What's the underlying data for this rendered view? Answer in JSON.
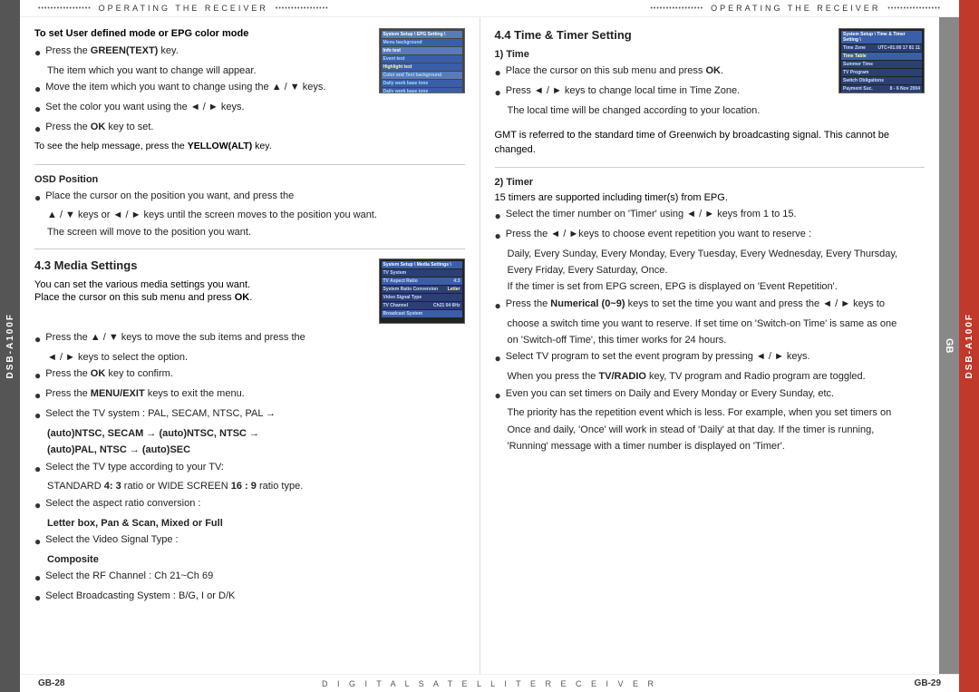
{
  "left_side_tab": "DSB-A100F",
  "right_side_tab": "DSB-A100F",
  "gb_tab": "GB",
  "header": {
    "dots_left": "•••••••••••••••••",
    "title_left": "OPERATING THE RECEIVER",
    "dots_right_1": "•••••••••••••••••",
    "dots_left_2": "•••••••••••••••••",
    "title_right": "OPERATING THE RECEIVER",
    "dots_right_2": "•••••••••••••••••"
  },
  "footer": {
    "left_page": "GB-28",
    "center": "D I G I T A L   S A T E L L I T E   R E C E I V E R",
    "right_page": "GB-29"
  },
  "left_column": {
    "set_user_defined_title": "To set User defined mode or EPG color mode",
    "set_user_defined_bullets": [
      {
        "bullet": "●",
        "text": "Press the GREEN(TEXT) key."
      },
      {
        "bullet": "",
        "indent": true,
        "text": "The item which you want to change will appear."
      },
      {
        "bullet": "●",
        "text": "Move the item which you want to change using the ▲ / ▼ keys."
      },
      {
        "bullet": "●",
        "text": "Set the color you want using the ◄ / ► keys."
      },
      {
        "bullet": "●",
        "text": "Press the OK key to set."
      }
    ],
    "yellow_alt_text": "To see the help message, press the YELLOW(ALT) key.",
    "osd_position_title": "OSD Position",
    "osd_position_bullets": [
      {
        "bullet": "●",
        "text": "Place the cursor on the position you want, and press the"
      },
      {
        "indent": true,
        "text": "▲ / ▼ keys or ◄ / ► keys until the screen moves to the position you want."
      },
      {
        "indent": true,
        "text": "The screen will move to the position you want."
      }
    ],
    "media_settings_title": "4.3 Media Settings",
    "media_settings_intro1": "You can set the various media settings you want.",
    "media_settings_intro2": "Place the cursor on this sub menu and press OK.",
    "media_settings_bullets": [
      {
        "bullet": "●",
        "text": "Press the ▲ / ▼ keys to move the sub items and press the"
      },
      {
        "indent": true,
        "text": "◄ / ► keys to select the option."
      },
      {
        "bullet": "●",
        "text": "Press the OK key to confirm."
      },
      {
        "bullet": "●",
        "text": "Press the MENU/EXIT keys to exit the menu."
      },
      {
        "bullet": "●",
        "text": "Select the TV system : PAL, SECAM, NTSC, PAL →"
      },
      {
        "indent": true,
        "bold": true,
        "text": "(auto)NTSC, SECAM → (auto)NTSC, NTSC →"
      },
      {
        "indent": true,
        "bold": true,
        "text": "(auto)PAL, NTSC → (auto)SEC"
      },
      {
        "bullet": "●",
        "text": "Select the TV type according to your TV:"
      },
      {
        "indent": true,
        "text": "STANDARD 4: 3 ratio or WIDE SCREEN 16 : 9 ratio type."
      },
      {
        "bullet": "●",
        "text": "Select the aspect ratio conversion :"
      },
      {
        "indent": true,
        "bold": true,
        "text": "Letter box, Pan & Scan, Mixed or Full"
      },
      {
        "bullet": "●",
        "text": "Select the Video Signal Type :"
      },
      {
        "indent": true,
        "bold": true,
        "text": "Composite"
      },
      {
        "bullet": "●",
        "text": "Select the RF Channel : Ch 21~Ch 69"
      },
      {
        "bullet": "●",
        "text": "Select Broadcasting System : B/G, I or D/K"
      }
    ]
  },
  "right_column": {
    "timer_setting_title": "4.4 Time & Timer Setting",
    "time_title": "1) Time",
    "time_bullets": [
      {
        "bullet": "●",
        "text": "Place the cursor on this sub menu and press OK."
      },
      {
        "bullet": "●",
        "text": "Press ◄ / ► keys to change local time in Time Zone."
      },
      {
        "indent": true,
        "text": "The local time will be changed according to your location."
      }
    ],
    "gmt_text": "GMT is referred to the standard time of Greenwich by broadcasting signal. This cannot be changed.",
    "timer_title": "2) Timer",
    "timer_intro": "15 timers are supported including timer(s) from EPG.",
    "timer_bullets": [
      {
        "bullet": "●",
        "text": "Select the timer number on 'Timer' using ◄ / ► keys from 1 to 15."
      },
      {
        "bullet": "●",
        "text": "Press the ◄ / ►keys to choose event repetition you want to reserve :"
      },
      {
        "indent": true,
        "text": "Daily, Every Sunday, Every Monday, Every Tuesday, Every Wednesday, Every Thursday,"
      },
      {
        "indent": true,
        "text": "Every Friday, Every Saturday, Once."
      },
      {
        "indent": true,
        "text": "If the timer is set from EPG screen, EPG is displayed on 'Event Repetition'."
      },
      {
        "bullet": "●",
        "text": "Press the Numerical (0~9) keys to set the time you want and press the ◄ / ► keys to"
      },
      {
        "indent": true,
        "text": "choose a switch time you want to reserve. If set time on 'Switch-on Time' is same as one"
      },
      {
        "indent": true,
        "text": "on 'Switch-off Time', this timer works for 24 hours."
      },
      {
        "bullet": "●",
        "text": "Select TV program to set the event program by pressing ◄ / ► keys."
      },
      {
        "indent": true,
        "text": "When you press the TV/RADIO key, TV program and Radio program are toggled."
      },
      {
        "bullet": "●",
        "text": "Even you can set timers on Daily and Every Monday or Every Sunday, etc."
      },
      {
        "indent": true,
        "text": "The priority has the repetition event which is less. For example, when you set timers on"
      },
      {
        "indent": true,
        "text": "Once and daily, 'Once' will work in stead of 'Daily' at that day. If the timer is running,"
      },
      {
        "indent": true,
        "text": "'Running' message with a timer number is displayed on 'Timer'."
      }
    ]
  }
}
